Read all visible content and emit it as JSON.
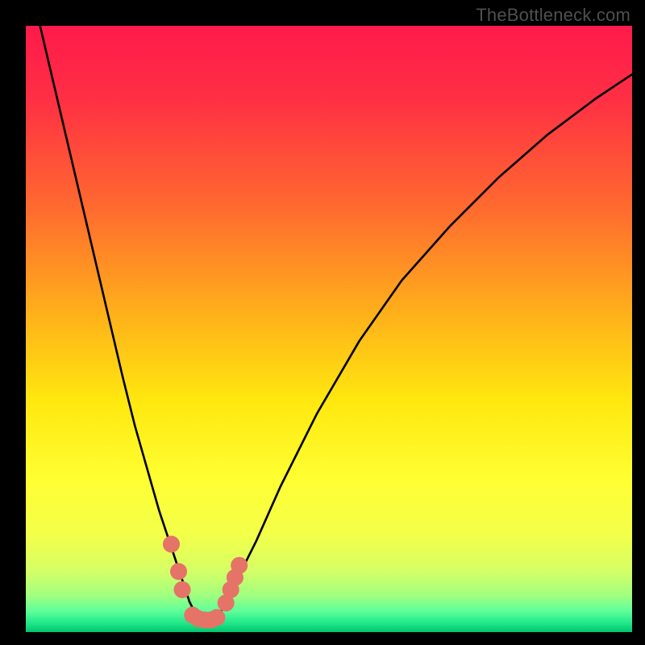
{
  "watermark": "TheBottleneck.com",
  "chart_data": {
    "type": "line",
    "title": "",
    "xlabel": "",
    "ylabel": "",
    "xlim": [
      0,
      100
    ],
    "ylim": [
      0,
      100
    ],
    "background_gradient": {
      "stops": [
        {
          "offset": 0.0,
          "color": "#ff1a4b"
        },
        {
          "offset": 0.12,
          "color": "#ff2f44"
        },
        {
          "offset": 0.3,
          "color": "#ff6a2f"
        },
        {
          "offset": 0.48,
          "color": "#ffb21a"
        },
        {
          "offset": 0.62,
          "color": "#ffe80f"
        },
        {
          "offset": 0.75,
          "color": "#ffff33"
        },
        {
          "offset": 0.84,
          "color": "#f3ff4a"
        },
        {
          "offset": 0.9,
          "color": "#d4ff66"
        },
        {
          "offset": 0.94,
          "color": "#a0ff80"
        },
        {
          "offset": 0.965,
          "color": "#60ff9a"
        },
        {
          "offset": 0.985,
          "color": "#20e88a"
        },
        {
          "offset": 1.0,
          "color": "#00c56d"
        }
      ]
    },
    "series": [
      {
        "name": "bottleneck-curve",
        "color": "#000000",
        "x": [
          0,
          4,
          8,
          12,
          16,
          18,
          20,
          22,
          24,
          25,
          26,
          27,
          28,
          29,
          30,
          31,
          32,
          33,
          35,
          38,
          42,
          48,
          55,
          62,
          70,
          78,
          86,
          94,
          100
        ],
        "y": [
          110,
          93,
          76,
          59,
          42,
          34,
          27,
          20,
          14,
          11,
          8,
          5,
          3,
          2,
          2,
          2,
          3,
          5,
          9,
          15,
          24,
          36,
          48,
          58,
          67,
          75,
          82,
          88,
          92
        ]
      }
    ],
    "markers": {
      "name": "highlight-points",
      "color": "#e57368",
      "points": [
        {
          "x": 24.0,
          "y": 14.5
        },
        {
          "x": 25.2,
          "y": 10.0
        },
        {
          "x": 25.8,
          "y": 7.0
        },
        {
          "x": 27.5,
          "y": 2.8
        },
        {
          "x": 28.5,
          "y": 2.2
        },
        {
          "x": 29.5,
          "y": 2.0
        },
        {
          "x": 30.5,
          "y": 2.0
        },
        {
          "x": 31.5,
          "y": 2.4
        },
        {
          "x": 33.0,
          "y": 4.8
        },
        {
          "x": 33.8,
          "y": 7.0
        },
        {
          "x": 34.5,
          "y": 9.0
        },
        {
          "x": 35.2,
          "y": 11.0
        }
      ],
      "radius": 1.4
    }
  }
}
